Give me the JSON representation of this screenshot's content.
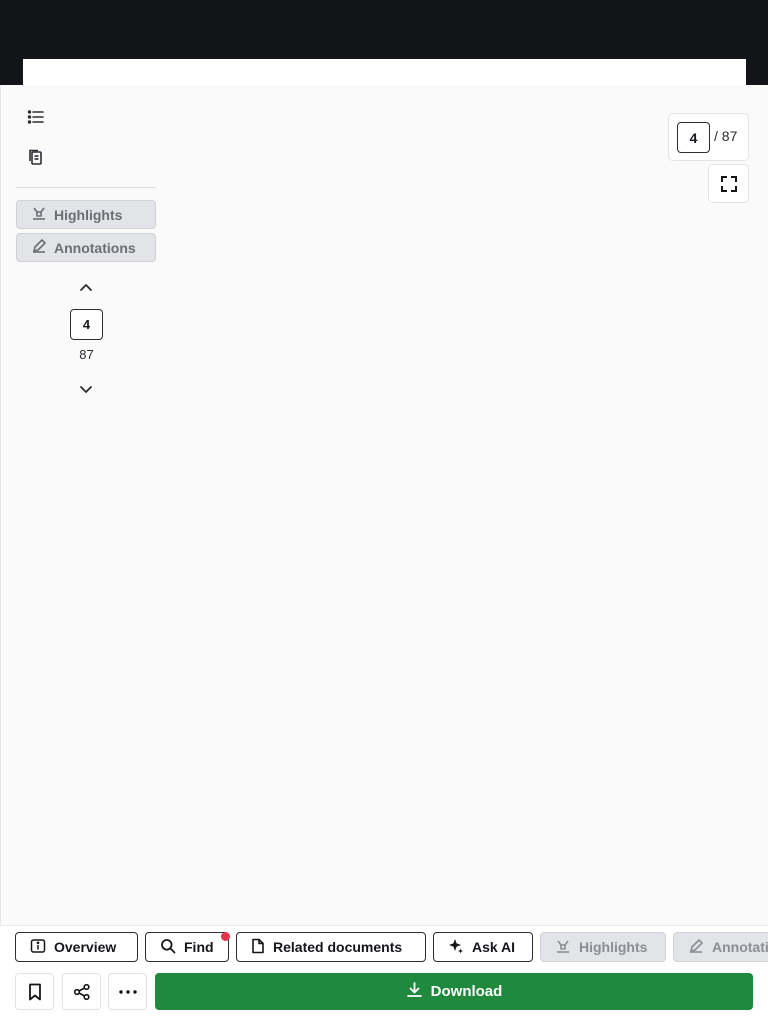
{
  "sidebar": {
    "highlights_label": "Highlights",
    "annotations_label": "Annotations",
    "current_page": "4",
    "total_pages": "87"
  },
  "viewer": {
    "current_page": "4",
    "total_label": "/ 87"
  },
  "toolbar": {
    "overview_label": "Overview",
    "find_label": "Find",
    "related_label": "Related documents",
    "ask_ai_label": "Ask AI",
    "highlights_label": "Highlights",
    "annotations_label": "Annotations",
    "download_label": "Download"
  },
  "colors": {
    "top_bar": "#121418",
    "download_button": "#1f8a3e",
    "notification_dot": "#e8344a"
  },
  "icons": [
    "list-icon",
    "pages-icon",
    "highlighter-icon",
    "pencil-icon",
    "chevron-up-icon",
    "chevron-down-icon",
    "fullscreen-icon",
    "info-icon",
    "search-icon",
    "document-icon",
    "sparkle-icon",
    "bookmark-icon",
    "share-icon",
    "more-icon",
    "download-icon"
  ]
}
